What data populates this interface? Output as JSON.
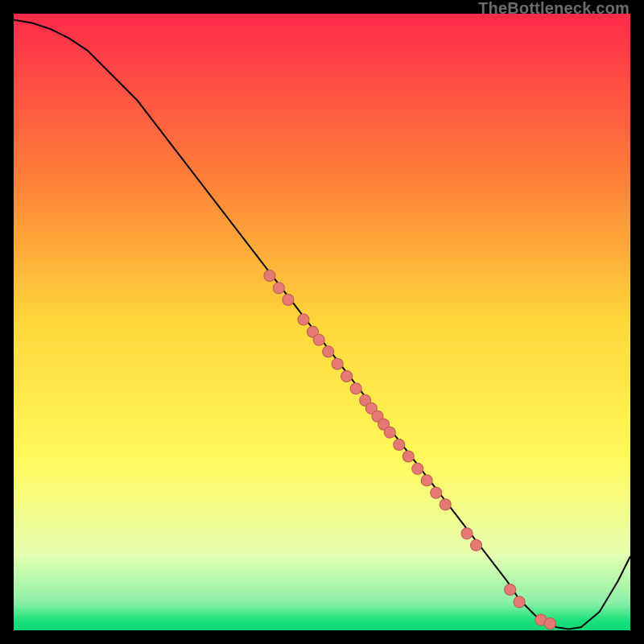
{
  "watermark": "TheBottleneck.com",
  "colors": {
    "stops": [
      {
        "offset": 0.0,
        "color": "#ff2a4b"
      },
      {
        "offset": 0.25,
        "color": "#ff7a3a"
      },
      {
        "offset": 0.5,
        "color": "#ffd73a"
      },
      {
        "offset": 0.72,
        "color": "#fff95a"
      },
      {
        "offset": 0.875,
        "color": "#e8ffb0"
      },
      {
        "offset": 0.955,
        "color": "#8cf0a8"
      },
      {
        "offset": 0.985,
        "color": "#18e07a"
      },
      {
        "offset": 1.0,
        "color": "#0fd874"
      }
    ],
    "curve": "#000000",
    "marker_fill": "#e47a72",
    "marker_stroke": "#be5a53"
  },
  "chart_data": {
    "type": "line",
    "title": "",
    "xlabel": "",
    "ylabel": "",
    "xlim": [
      0,
      100
    ],
    "ylim": [
      0,
      100
    ],
    "grid": false,
    "legend": null,
    "series": [
      {
        "name": "bottleneck-curve",
        "x": [
          0,
          3,
          6,
          9,
          12,
          15,
          20,
          30,
          40,
          50,
          55,
          60,
          65,
          70,
          75,
          80,
          82,
          85,
          88,
          90,
          92,
          95,
          98,
          100
        ],
        "y": [
          99,
          98.5,
          97.5,
          96,
          94,
          91,
          86,
          73,
          60,
          47,
          40.5,
          34,
          27.5,
          21,
          14.5,
          8,
          5,
          2,
          0.5,
          0.2,
          0.5,
          3,
          8,
          12
        ]
      }
    ],
    "markers": {
      "name": "sample-points",
      "type": "scatter",
      "x": [
        41.5,
        43.0,
        44.5,
        47.0,
        48.5,
        49.5,
        51.0,
        52.5,
        54.0,
        55.5,
        57.0,
        58.0,
        59.0,
        60.0,
        61.0,
        62.5,
        64.0,
        65.5,
        67.0,
        68.5,
        70.0,
        73.5,
        75.0,
        80.5,
        82.0,
        85.5,
        87.0
      ],
      "y": [
        57.5,
        55.5,
        53.6,
        50.4,
        48.4,
        47.1,
        45.2,
        43.2,
        41.2,
        39.2,
        37.3,
        36.0,
        34.7,
        33.4,
        32.1,
        30.1,
        28.2,
        26.2,
        24.3,
        22.3,
        20.4,
        15.7,
        13.8,
        6.6,
        4.6,
        1.7,
        1.1
      ],
      "r": 7
    }
  }
}
